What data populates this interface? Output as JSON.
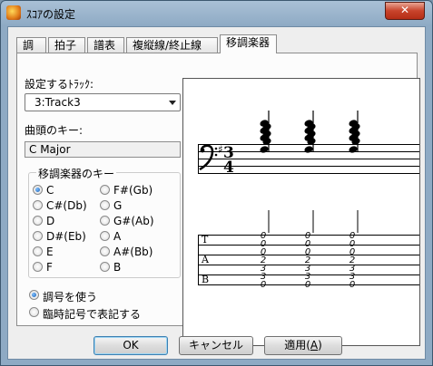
{
  "window": {
    "title": "ｽｺｱの設定",
    "close_glyph": "✕"
  },
  "tabs": [
    {
      "label": "調",
      "active": false
    },
    {
      "label": "拍子",
      "active": false
    },
    {
      "label": "譜表",
      "active": false
    },
    {
      "label": "複縦線/終止線",
      "active": false
    },
    {
      "label": "移調楽器",
      "active": true
    }
  ],
  "track": {
    "label": "設定するﾄﾗｯｸ:",
    "selected": "3:Track3"
  },
  "key": {
    "label": "曲頭のキー:",
    "value": "C Major"
  },
  "transpose_group": {
    "legend": "移調楽器のキー",
    "options": [
      {
        "label": "C",
        "checked": true
      },
      {
        "label": "F#(Gb)",
        "checked": false
      },
      {
        "label": "C#(Db)",
        "checked": false
      },
      {
        "label": "G",
        "checked": false
      },
      {
        "label": "D",
        "checked": false
      },
      {
        "label": "G#(Ab)",
        "checked": false
      },
      {
        "label": "D#(Eb)",
        "checked": false
      },
      {
        "label": "A",
        "checked": false
      },
      {
        "label": "E",
        "checked": false
      },
      {
        "label": "A#(Bb)",
        "checked": false
      },
      {
        "label": "F",
        "checked": false
      },
      {
        "label": "B",
        "checked": false
      }
    ]
  },
  "notation": {
    "options": [
      {
        "label": "調号を使う",
        "checked": true
      },
      {
        "label": "臨時記号で表記する",
        "checked": false
      }
    ]
  },
  "preview": {
    "time_signature": {
      "top": "3",
      "bottom": "4"
    },
    "tab_letters": [
      "T",
      "A",
      "B"
    ],
    "fret_numbers": [
      "0",
      "0",
      "0",
      "2",
      "3",
      "3",
      "0"
    ]
  },
  "buttons": {
    "ok": "OK",
    "cancel": "キャンセル",
    "apply_prefix": "適用(",
    "apply_key": "A",
    "apply_suffix": ")"
  }
}
